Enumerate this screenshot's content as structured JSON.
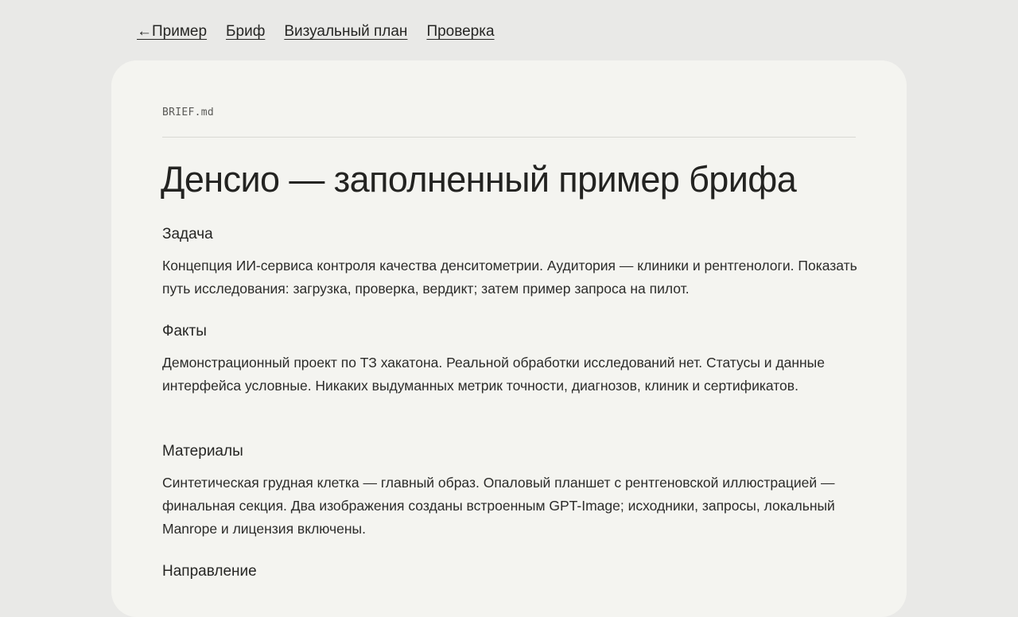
{
  "nav": {
    "back_arrow": "←",
    "back_label": "Пример",
    "brief": "Бриф",
    "visual_plan": "Визуальный план",
    "check": "Проверка"
  },
  "document": {
    "filename": "BRIEF.md",
    "title": "Денсио — заполненный пример брифа",
    "sections": [
      {
        "heading": "Задача",
        "text": "Концепция ИИ-сервиса контроля качества денситометрии. Аудитория — клиники и рентгенологи. Показать путь исследования: загрузка, проверка, вердикт; затем пример запроса на пилот."
      },
      {
        "heading": "Факты",
        "text": "Демонстрационный проект по ТЗ хакатона. Реальной обработки исследований нет. Статусы и данные интерфейса условные. Никаких выдуманных метрик точности, диагнозов, клиник и сертификатов."
      },
      {
        "heading": "Материалы",
        "text": "Синтетическая грудная клетка — главный образ. Опаловый планшет с рентгеновской иллюстрацией — финальная секция. Два изображения созданы встроенным GPT-Image; исходники, запросы, локальный Manrope и лицензия включены."
      },
      {
        "heading": "Направление",
        "text": ""
      }
    ]
  },
  "colors": {
    "page_background": "#e9e9e7",
    "card_background": "#f4f4f0",
    "text": "#262624",
    "divider": "#d9d9d4"
  }
}
